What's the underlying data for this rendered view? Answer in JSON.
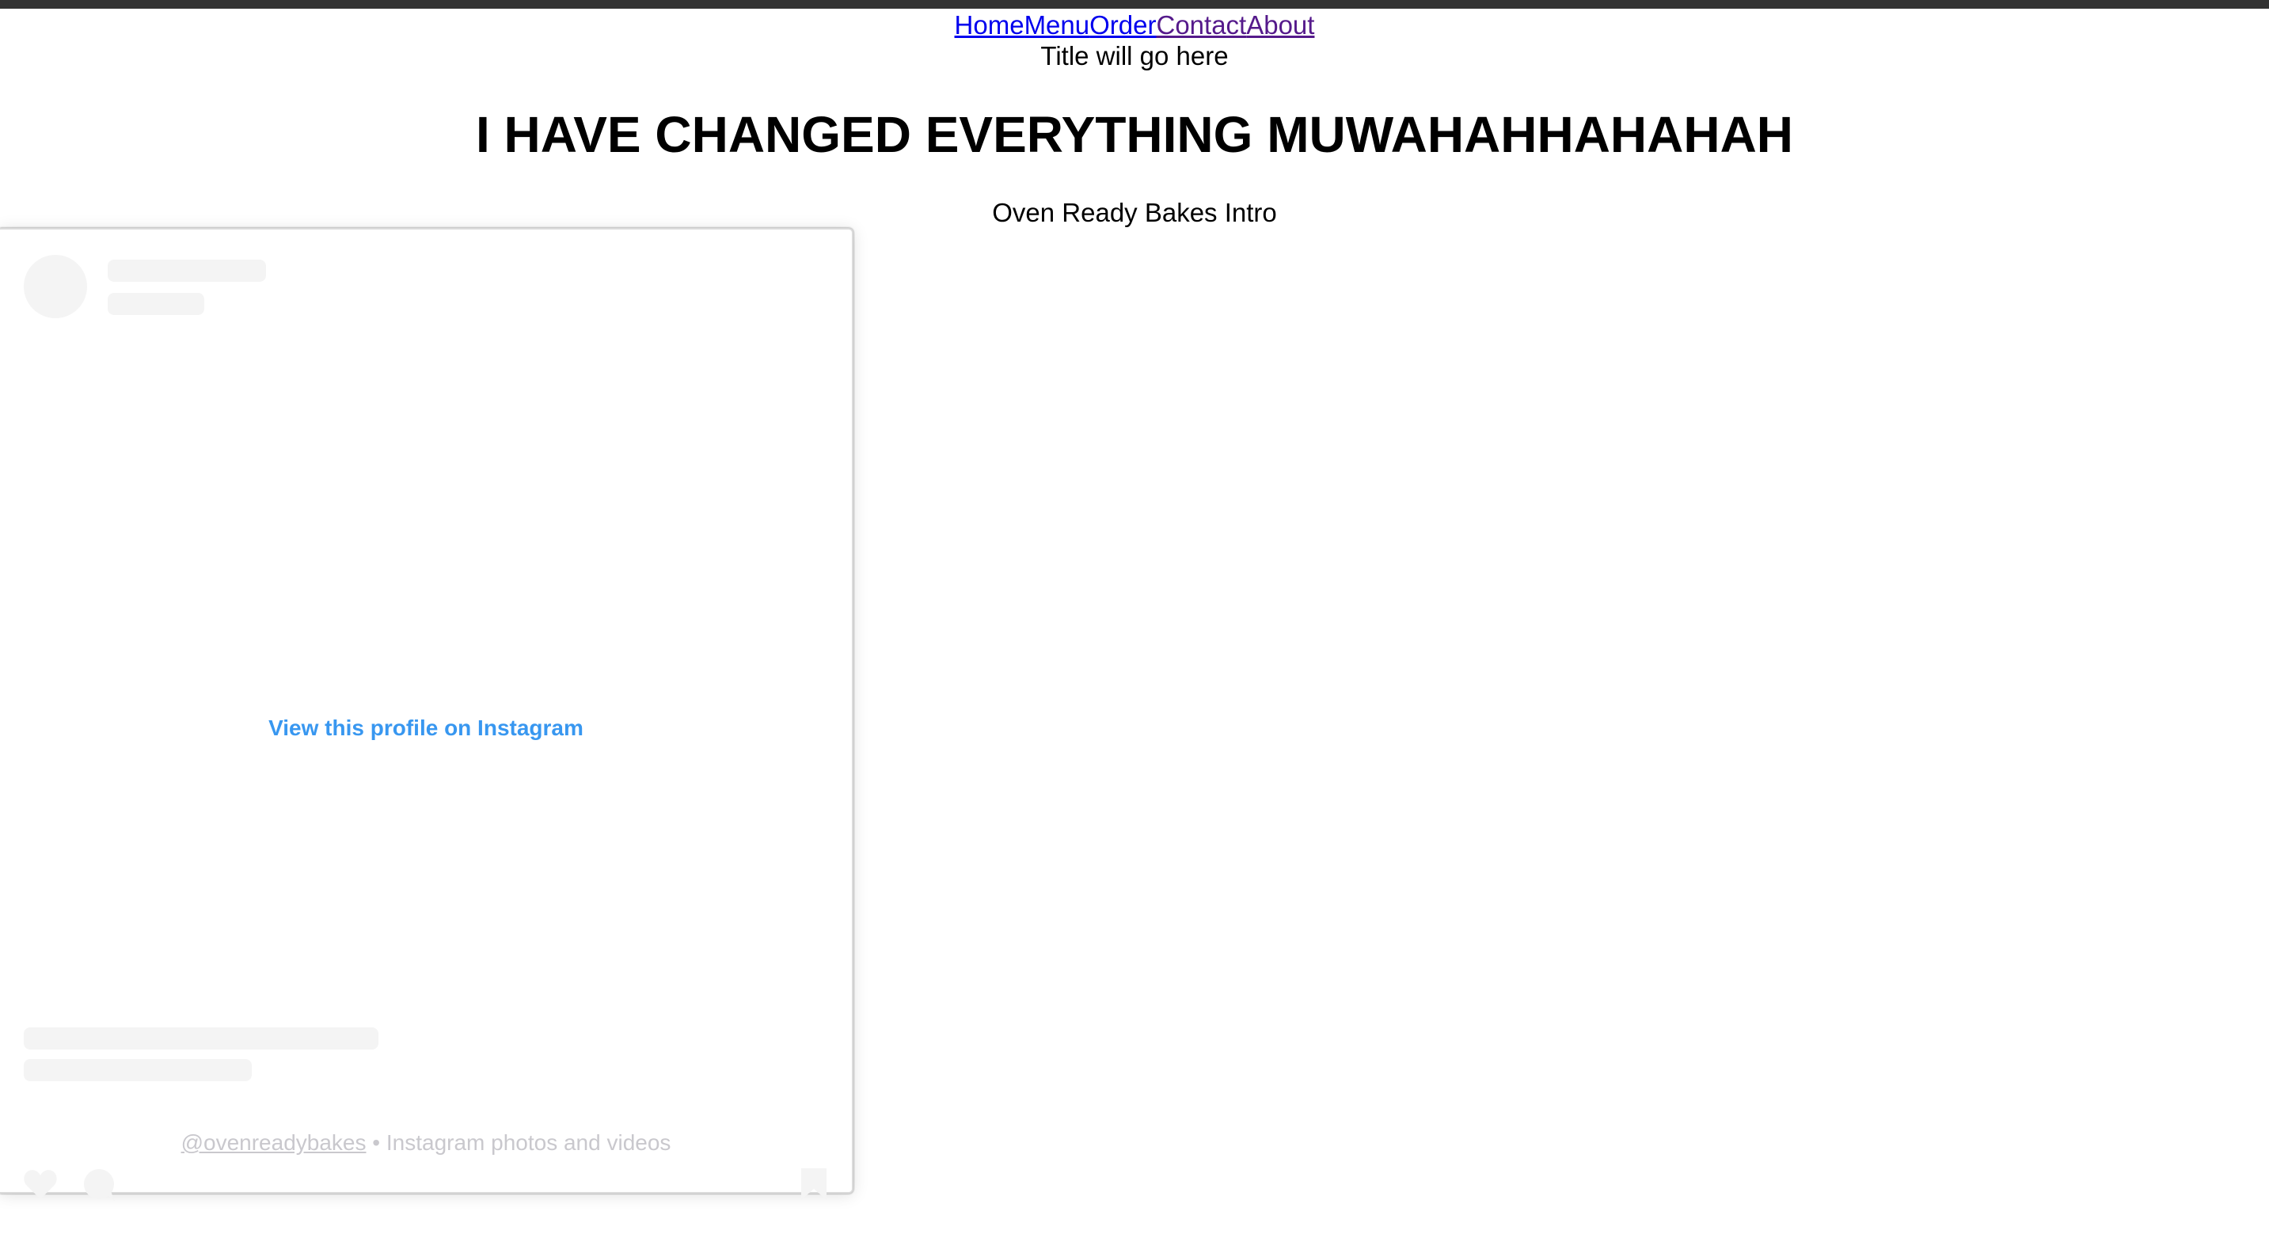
{
  "nav": {
    "items": [
      {
        "label": "Home",
        "visited": false
      },
      {
        "label": "Menu",
        "visited": false
      },
      {
        "label": "Order",
        "visited": false
      },
      {
        "label": "Contact",
        "visited": true
      },
      {
        "label": "About",
        "visited": true
      }
    ]
  },
  "page": {
    "subtitle": "Title will go here",
    "headline": "I HAVE CHANGED EVERYTHING MUWAHAHHAHAHAH",
    "intro": "Oven Ready Bakes Intro"
  },
  "instagram_embed": {
    "view_profile_link": "View this profile on Instagram",
    "footer_handle": "@ovenreadybakes",
    "footer_separator": " • ",
    "footer_text": "Instagram photos and videos",
    "icons": [
      "heart-icon",
      "comment-icon",
      "bookmark-icon"
    ]
  },
  "colors": {
    "top_bar": "#333333",
    "link": "#0000ee",
    "visited_link": "#551a8b",
    "instagram_blue": "#3897f0",
    "placeholder_gray": "#f4f4f4",
    "footer_gray": "#c9c8cd"
  }
}
